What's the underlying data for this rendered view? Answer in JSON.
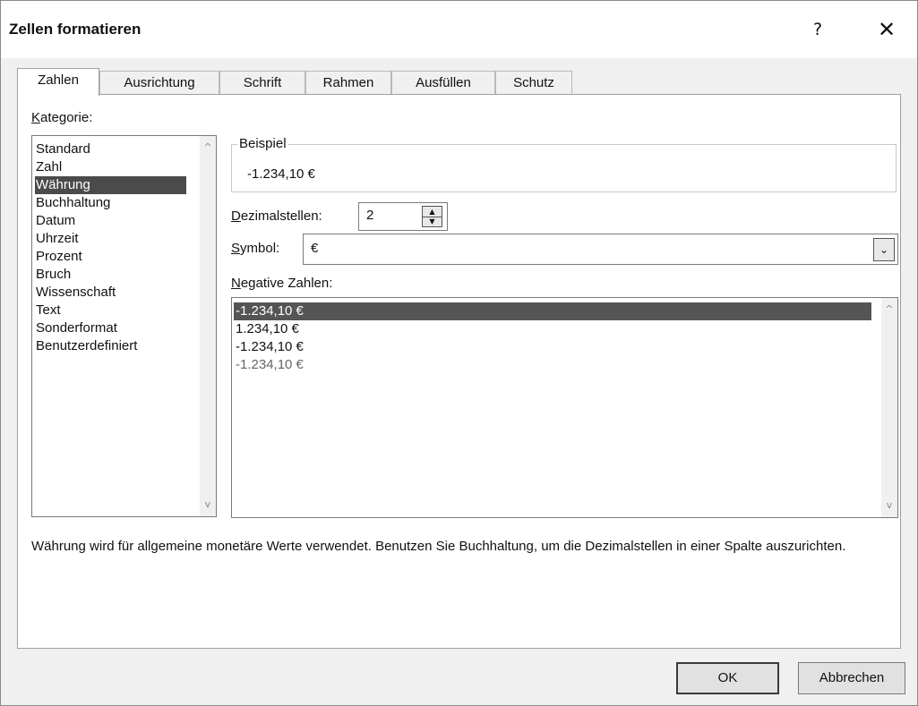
{
  "dialog": {
    "title": "Zellen formatieren",
    "help": "?",
    "close": "✕"
  },
  "tabs": [
    "Zahlen",
    "Ausrichtung",
    "Schrift",
    "Rahmen",
    "Ausfüllen",
    "Schutz"
  ],
  "active_tab": "Zahlen",
  "category": {
    "label_accel": "K",
    "label_rest": "ategorie:",
    "items": [
      "Standard",
      "Zahl",
      "Währung",
      "Buchhaltung",
      "Datum",
      "Uhrzeit",
      "Prozent",
      "Bruch",
      "Wissenschaft",
      "Text",
      "Sonderformat",
      "Benutzerdefiniert"
    ],
    "selected": "Währung"
  },
  "sample": {
    "legend": "Beispiel",
    "value": "-1.234,10 €"
  },
  "decimals": {
    "label_accel": "D",
    "label_rest": "ezimalstellen:",
    "value": "2"
  },
  "symbol": {
    "label_accel": "S",
    "label_rest": "ymbol:",
    "value": "€"
  },
  "negative": {
    "label_accel": "N",
    "label_rest": "egative Zahlen:",
    "items": [
      "-1.234,10 €",
      "1.234,10 €",
      "-1.234,10 €",
      "-1.234,10 €"
    ],
    "selected_index": 0
  },
  "description": "Währung wird für allgemeine monetäre Werte verwendet. Benutzen Sie Buchhaltung, um die Dezimalstellen in einer Spalte auszurichten.",
  "buttons": {
    "ok": "OK",
    "cancel": "Abbrechen"
  },
  "icons": {
    "scroll_up": "^",
    "scroll_down": "v",
    "spin_up": "▲",
    "spin_down": "▼",
    "dropdown": "⌄"
  }
}
